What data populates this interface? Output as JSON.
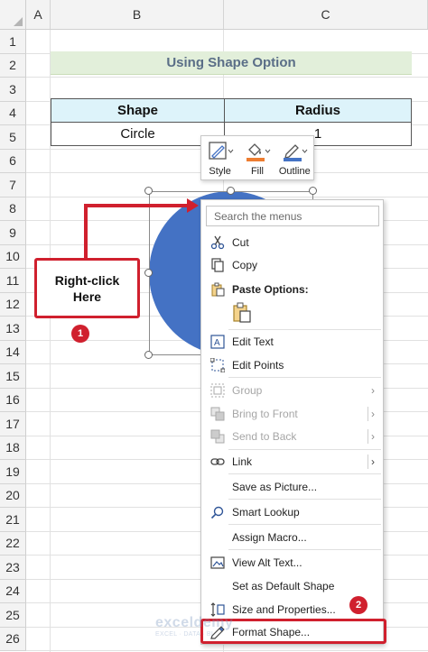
{
  "columns": [
    "A",
    "B",
    "C"
  ],
  "rows": [
    "1",
    "2",
    "3",
    "4",
    "5",
    "6",
    "7",
    "8",
    "9",
    "10",
    "11",
    "12",
    "13",
    "14",
    "15",
    "16",
    "17",
    "18",
    "19",
    "20",
    "21",
    "22",
    "23",
    "24",
    "25",
    "26"
  ],
  "title": "Using Shape Option",
  "table": {
    "headers": [
      "Shape",
      "Radius"
    ],
    "row": [
      "Circle",
      "1"
    ]
  },
  "callout": {
    "text": "Right-click\nHere",
    "step": "1"
  },
  "step2": "2",
  "mini_toolbar": {
    "items": [
      {
        "label": "Style",
        "icon": "style-icon"
      },
      {
        "label": "Fill",
        "icon": "fill-bucket-icon"
      },
      {
        "label": "Outline",
        "icon": "outline-pen-icon"
      }
    ]
  },
  "colors": {
    "fill_accent": "#ed7d31",
    "outline_accent": "#4472c4",
    "shape_fill": "#4472c4",
    "highlight": "#d0202e"
  },
  "menu": {
    "search_placeholder": "Search the menus",
    "items": {
      "cut": "Cut",
      "copy": "Copy",
      "paste_options": "Paste Options:",
      "edit_text": "Edit Text",
      "edit_points": "Edit Points",
      "group": "Group",
      "bring_to_front": "Bring to Front",
      "send_to_back": "Send to Back",
      "link": "Link",
      "save_as_picture": "Save as Picture...",
      "smart_lookup": "Smart Lookup",
      "assign_macro": "Assign Macro...",
      "view_alt_text": "View Alt Text...",
      "set_default_shape": "Set as Default Shape",
      "size_properties": "Size and Properties...",
      "format_shape": "Format Shape..."
    }
  },
  "watermark": {
    "name": "exceldemy",
    "tagline": "EXCEL · DATA · BI"
  }
}
